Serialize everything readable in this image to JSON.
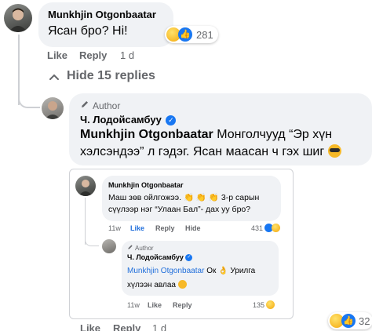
{
  "top_comment": {
    "author": "Munkhjin Otgonbaatar",
    "text": "Ясан бро? Hi!",
    "reaction_count": "281",
    "like": "Like",
    "reply": "Reply",
    "time": "1 d"
  },
  "hide_replies": "Hide 15 replies",
  "reply_comment": {
    "author_tag": "Author",
    "author": "Ч. Лодойсамбуу",
    "mention": "Munkhjin Otgonbaatar",
    "text_line1": "Монголчууд “Эр хүн",
    "text_line2": "хэлсэндээ” л гэдэг. Ясан маасан ч гэх шиг",
    "like": "Like",
    "reply": "Reply",
    "time": "1 d",
    "reaction_count": "32"
  },
  "embedded": {
    "comment": {
      "author": "Munkhjin Otgonbaatar",
      "text_line1": "Маш зөв ойлгожээ.",
      "text_line1b": "3-р сарын",
      "text_line2": "сүүлээр нэг “Улаан Бал”- дах уу бро?",
      "time": "11w",
      "like": "Like",
      "reply": "Reply",
      "hide": "Hide",
      "reaction_count": "431"
    },
    "reply": {
      "author_tag": "Author",
      "author": "Ч. Лодойсамбуу",
      "mention": "Munkhjin Otgonbaatar",
      "text_ok": "Ок",
      "text_after": "Урилга",
      "text_line2": "хүлээн авлаа",
      "time": "11w",
      "like": "Like",
      "reply": "Reply",
      "reaction_count": "135"
    }
  },
  "colors": {
    "link_blue": "#216fdb",
    "verified_blue": "#1877f2",
    "muted": "#65676b",
    "bubble": "#f0f2f5"
  }
}
